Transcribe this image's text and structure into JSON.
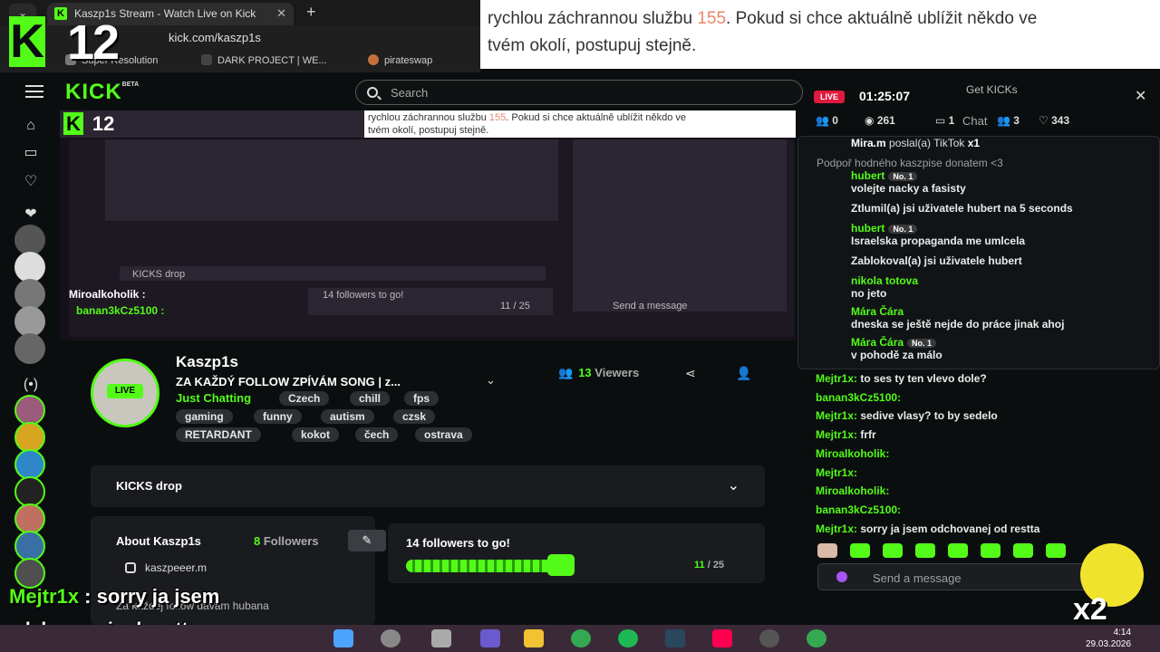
{
  "browser": {
    "tab_title": "Kaszp1s Stream - Watch Live on Kick",
    "url": "kick.com/kaszp1s",
    "bookmarks": [
      "Super Resolution",
      "DARK PROJECT | WE...",
      "pirateswap"
    ]
  },
  "overlay": {
    "logo_letter": "K",
    "logo_number": "12"
  },
  "notice": {
    "line1_pre": "rychlou záchrannou službu ",
    "line1_num": "155",
    "line1_post": ". Pokud si chce aktuálně ublížit někdo ve",
    "line2": "tvém okolí, postupuj stejně."
  },
  "app": {
    "logo": "KICK",
    "logo_beta": "BETA",
    "search_placeholder": "Search"
  },
  "video": {
    "notice_pre": "rychlou záchrannou službu ",
    "notice_num": "155",
    "notice_post": ". Pokud si chce aktuálně ublížit někdo ve",
    "notice_line2": "tvém okolí, postupuj stejně.",
    "caption_user": "Miroalkoholik :",
    "caption_user2": "banan3kCz5100 :",
    "inner_kicks": "KICKS drop",
    "inner_goal": "14 followers to go!",
    "inner_goal_count": "11 / 25",
    "inner_send": "Send a message"
  },
  "stream": {
    "channel": "Kaszp1s",
    "title": "ZA KAŽDÝ FOLLOW ZPÍVÁM SONG | z...",
    "category": "Just Chatting",
    "live": "LIVE",
    "viewers_count": "13",
    "viewers_label": "Viewers",
    "tags": [
      "Czech",
      "chill",
      "fps",
      "gaming",
      "funny",
      "autism",
      "czsk",
      "RETARDANT",
      "kokot",
      "čech",
      "ostrava"
    ]
  },
  "kicks_drop": {
    "label": "KICKS drop"
  },
  "about": {
    "title": "About Kaszp1s",
    "followers_count": "8",
    "followers_label": "Followers",
    "instagram": "kaszpeeer.m",
    "description": "Za každej follow dávám hubana"
  },
  "goal": {
    "title": "14 followers to go!",
    "current": "11",
    "target": "/ 25",
    "progress": 0.44
  },
  "chat": {
    "live": "LIVE",
    "timer": "01:25:07",
    "get_kicks": "Get KICKs",
    "header": "Chat",
    "stats": [
      "0",
      "261",
      "1",
      "3",
      "343"
    ],
    "pinned": [
      {
        "user": "Mira.m",
        "text": "poslal(a) TikTok",
        "extra": "x1"
      },
      {
        "user": "",
        "text": "Podpoř hodného kaszpise donatem <3",
        "extra": ""
      },
      {
        "user": "hubert",
        "text": "volejte nacky a fasisty",
        "extra": "No. 1"
      },
      {
        "user": "",
        "text": "Ztlumil(a) jsi uživatele hubert na 5 seconds",
        "extra": ""
      },
      {
        "user": "hubert",
        "text": "Israelska propaganda me umlcela",
        "extra": "No. 1"
      },
      {
        "user": "",
        "text": "Zablokoval(a) jsi uživatele hubert",
        "extra": ""
      },
      {
        "user": "nikola totova",
        "text": "no jeto",
        "extra": ""
      },
      {
        "user": "Mára Čára",
        "text": "dneska se ještě nejde do práce jinak ahoj",
        "extra": ""
      },
      {
        "user": "Mára Čára",
        "text": "v pohodě za málo",
        "extra": "No. 1"
      }
    ],
    "messages": [
      {
        "user": "Mejtr1x:",
        "text": "to ses ty ten vlevo dole?"
      },
      {
        "user": "banan3kCz5100:",
        "text": ""
      },
      {
        "user": "Mejtr1x:",
        "text": "sedive vlasy? to by sedelo"
      },
      {
        "user": "Mejtr1x:",
        "text": "frfr"
      },
      {
        "user": "Miroalkoholik:",
        "text": ""
      },
      {
        "user": "Mejtr1x:",
        "text": ""
      },
      {
        "user": "Miroalkoholik:",
        "text": ""
      },
      {
        "user": "banan3kCz5100:",
        "text": ""
      },
      {
        "user": "Mejtr1x:",
        "text": "sorry ja jsem odchovanej od restta"
      }
    ],
    "send_placeholder": "Send a message"
  },
  "captions": {
    "user": "Mejtr1x",
    "line1": " : sorry ja jsem",
    "line2": "odchovanej od restta",
    "mascot": "x2"
  },
  "taskbar": {
    "time": "4:14",
    "date": "29.03.2026"
  }
}
